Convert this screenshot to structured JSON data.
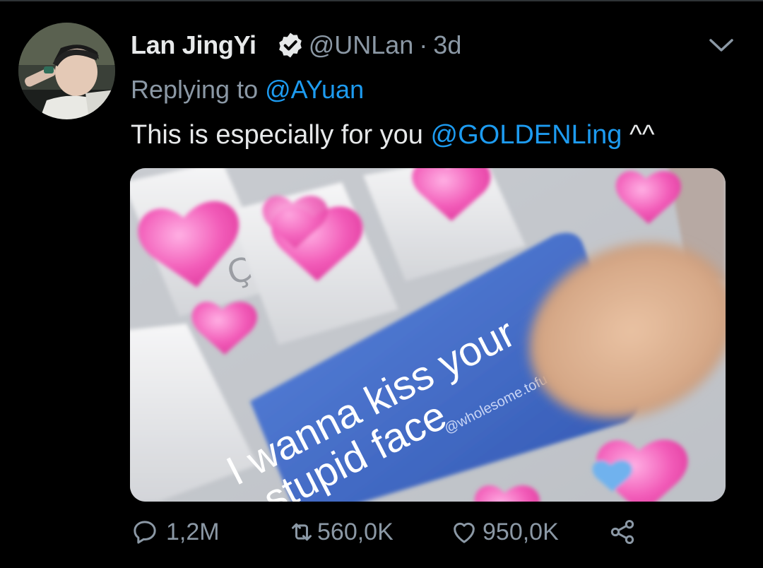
{
  "tweet": {
    "display_name": "Lan JingYi",
    "verified_icon": "verified-badge-icon",
    "handle": "@UNLan",
    "separator": "·",
    "timestamp": "3d",
    "replying_prefix": "Replying to",
    "replying_to": "@AYuan",
    "text_before": "This is especially for you ",
    "text_mention": "@GOLDENLing",
    "text_after": " ^^",
    "media": {
      "caption_line1": "I wanna kiss your",
      "caption_line2": "stupid face",
      "watermark": "@wholesome.tofu",
      "key_glyph": "Ç"
    }
  },
  "actions": {
    "reply_count": "1,2M",
    "retweet_count": "560,0K",
    "like_count": "950,0K"
  },
  "colors": {
    "background": "#000000",
    "text": "#e7e9ea",
    "muted": "#8b98a5",
    "link": "#1d9bf0",
    "heart_pink": "#f25bb8",
    "key_blue": "#3c66c4"
  }
}
